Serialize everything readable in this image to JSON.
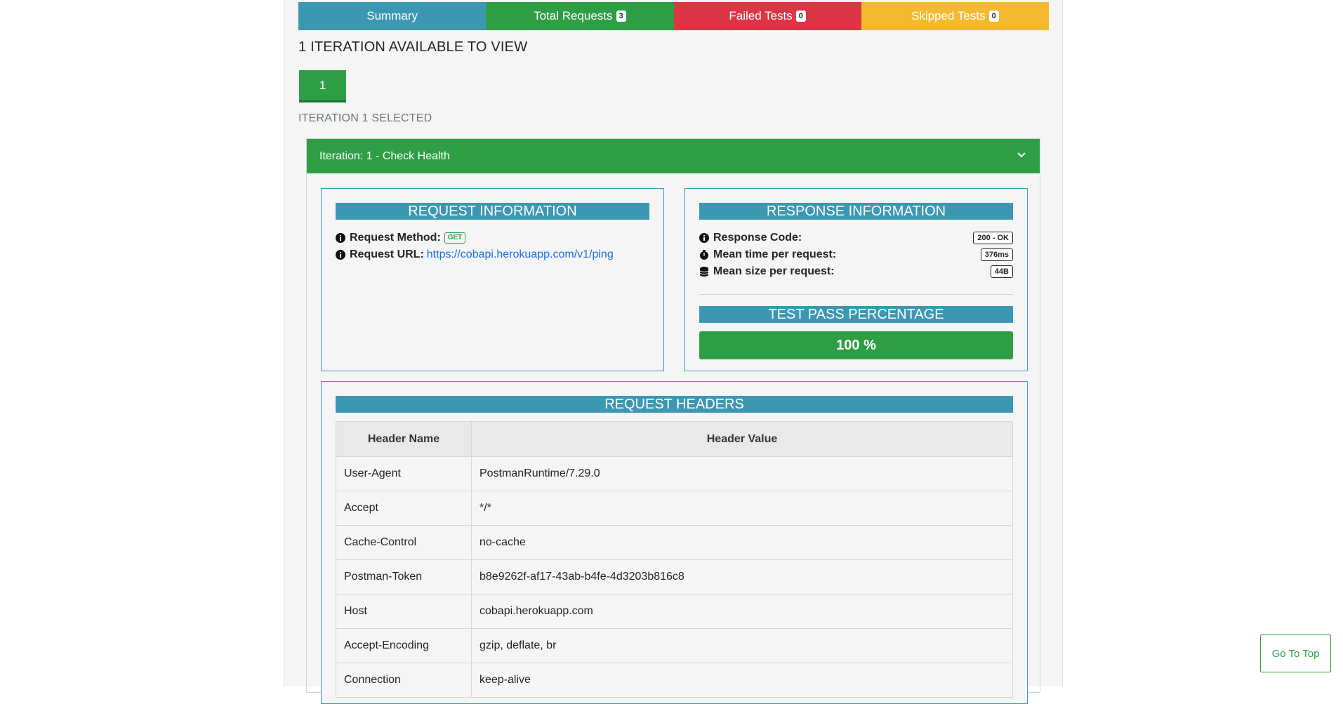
{
  "tabs": {
    "summary": {
      "label": "Summary",
      "color": "#3c97b3"
    },
    "total": {
      "label": "Total Requests",
      "count": "3",
      "color": "#2e9e44"
    },
    "failed": {
      "label": "Failed Tests",
      "count": "0",
      "color": "#dc3545"
    },
    "skipped": {
      "label": "Skipped Tests",
      "count": "0",
      "color": "#f4b92f"
    }
  },
  "iterations": {
    "title": "1 ITERATION AVAILABLE TO VIEW",
    "button_label": "1",
    "selected_text": "ITERATION 1 SELECTED"
  },
  "accordion": {
    "title": "Iteration: 1 - Check Health",
    "icon": "chevron-down-icon"
  },
  "request_info": {
    "title": "REQUEST INFORMATION",
    "method_label": "Request Method:",
    "method_value": "GET",
    "url_label": "Request URL:",
    "url_value": "https://cobapi.herokuapp.com/v1/ping"
  },
  "response_info": {
    "title": "RESPONSE INFORMATION",
    "code_label": "Response Code:",
    "code_value": "200 - OK",
    "time_label": "Mean time per request:",
    "time_value": "376ms",
    "size_label": "Mean size per request:",
    "size_value": "44B",
    "pass_title": "TEST PASS PERCENTAGE",
    "pass_value": "100 %",
    "pass_fraction": 1.0
  },
  "request_headers": {
    "title": "REQUEST HEADERS",
    "columns": [
      "Header Name",
      "Header Value"
    ],
    "rows": [
      [
        "User-Agent",
        "PostmanRuntime/7.29.0"
      ],
      [
        "Accept",
        "*/*"
      ],
      [
        "Cache-Control",
        "no-cache"
      ],
      [
        "Postman-Token",
        "b8e9262f-af17-43ab-b4fe-4d3203b816c8"
      ],
      [
        "Host",
        "cobapi.herokuapp.com"
      ],
      [
        "Accept-Encoding",
        "gzip, deflate, br"
      ],
      [
        "Connection",
        "keep-alive"
      ]
    ]
  },
  "go_top": {
    "label": "Go To Top"
  }
}
